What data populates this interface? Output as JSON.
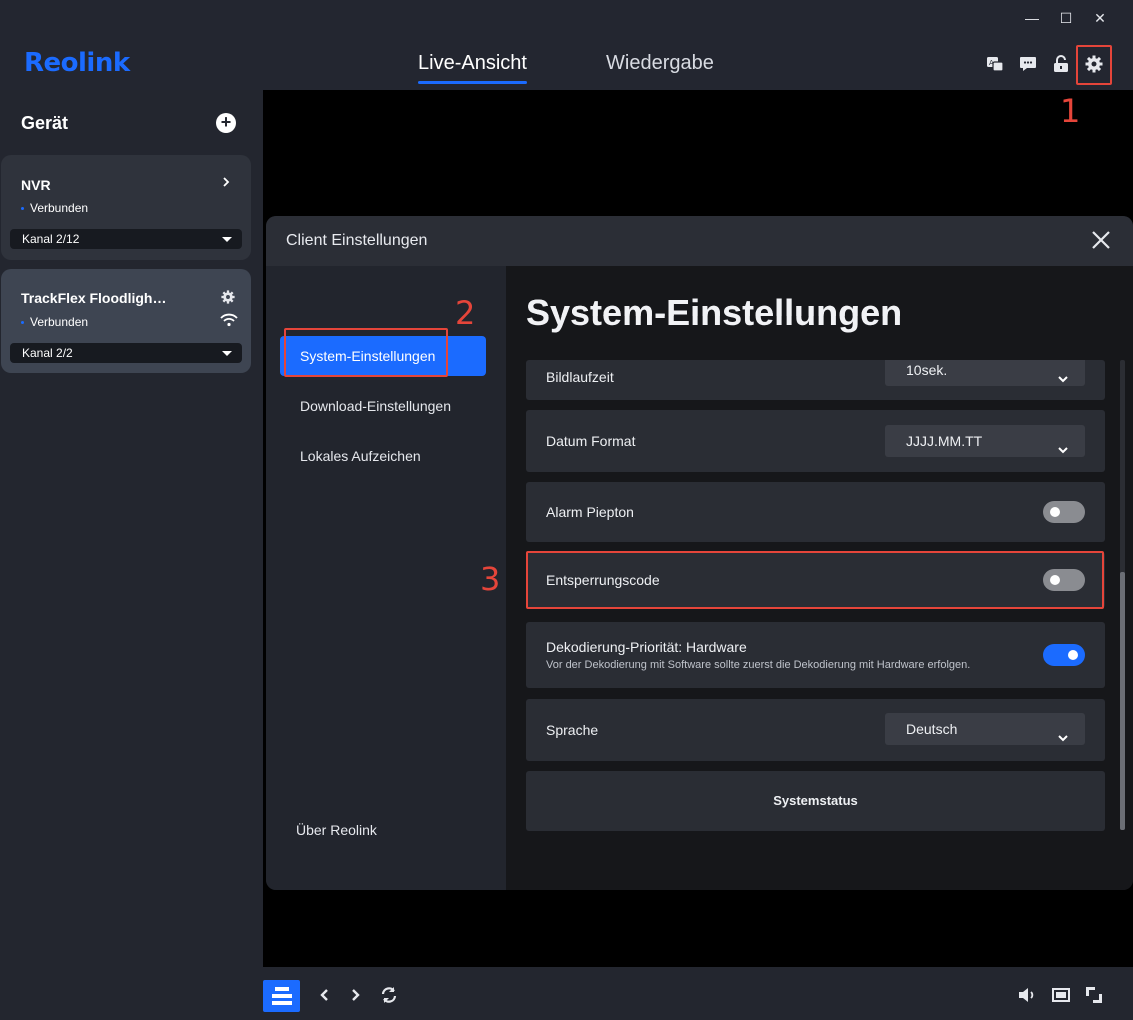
{
  "window": {
    "minimize": "—",
    "maximize": "☐",
    "close": "✕"
  },
  "header": {
    "logo": "Reolink",
    "tabs": [
      {
        "label": "Live-Ansicht",
        "active": true
      },
      {
        "label": "Wiedergabe",
        "active": false
      }
    ],
    "icons": [
      "translate-icon",
      "message-icon",
      "unlock-icon",
      "settings-icon"
    ]
  },
  "sidebar": {
    "title": "Gerät",
    "devices": [
      {
        "name": "NVR",
        "status": "Verbunden",
        "channel": "Kanal 2/12"
      },
      {
        "name": "TrackFlex Floodligh…",
        "status": "Verbunden",
        "channel": "Kanal 2/2"
      }
    ]
  },
  "dialog": {
    "title": "Client Einstellungen",
    "nav": [
      {
        "label": "System-Einstellungen",
        "active": true
      },
      {
        "label": "Download-Einstellungen",
        "active": false
      },
      {
        "label": "Lokales Aufzeichen",
        "active": false
      }
    ],
    "about": "Über Reolink",
    "main_title": "System-Einstellungen",
    "settings": {
      "bildlaufzeit": {
        "label": "Bildlaufzeit",
        "value": "10sek."
      },
      "datum_format": {
        "label": "Datum Format",
        "value": "JJJJ.MM.TT"
      },
      "alarm_piepton": {
        "label": "Alarm Piepton",
        "enabled": false
      },
      "entsperrungscode": {
        "label": "Entsperrungscode",
        "enabled": false
      },
      "dekodierung": {
        "label": "Dekodierung-Priorität: Hardware",
        "description": "Vor der Dekodierung mit Software sollte zuerst die Dekodierung mit Hardware erfolgen.",
        "enabled": true
      },
      "sprache": {
        "label": "Sprache",
        "value": "Deutsch"
      }
    },
    "systemstatus_label": "Systemstatus"
  },
  "annotations": [
    "1",
    "2",
    "3"
  ],
  "colors": {
    "accent": "#1b6bff",
    "annotation": "#e5453a",
    "panel": "#2a2d34"
  }
}
